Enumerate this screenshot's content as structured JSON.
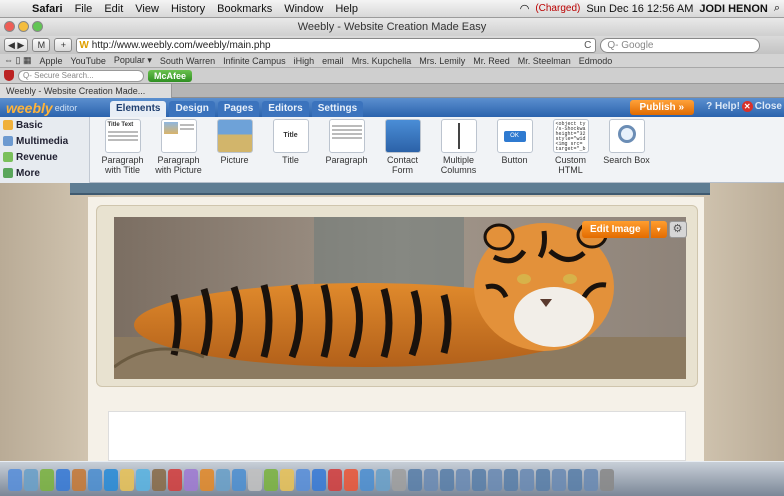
{
  "menubar": {
    "app": "Safari",
    "items": [
      "File",
      "Edit",
      "View",
      "History",
      "Bookmarks",
      "Window",
      "Help"
    ],
    "battery_status": "(Charged)",
    "datetime": "Sun Dec 16  12:56 AM",
    "user": "JODI HENON"
  },
  "window": {
    "title": "Weebly - Website Creation Made Easy"
  },
  "toolbar": {
    "url": "http://www.weebly.com/weebly/main.php",
    "search_placeholder": "Q- Google",
    "reload": "C"
  },
  "bookmarks": [
    "Apple",
    "YouTube",
    "Popular ▾",
    "South Warren",
    "Infinite Campus",
    "iHigh",
    "email",
    "Mrs. Kupchella",
    "Mrs. Lemily",
    "Mr. Reed",
    "Mr. Steelman",
    "Edmodo"
  ],
  "security_bar": {
    "search_placeholder": "Q- Secure Search...",
    "mcafee_label": "McAfee"
  },
  "tab": {
    "label": "Weebly - Website Creation Made..."
  },
  "weebly": {
    "logo": "weebly",
    "logo_sub": "editor",
    "tabs": [
      "Elements",
      "Design",
      "Pages",
      "Editors",
      "Settings"
    ],
    "active_tab": "Elements",
    "publish": "Publish »",
    "help": "Help!",
    "close": "Close"
  },
  "categories": [
    "Basic",
    "Multimedia",
    "Revenue",
    "More"
  ],
  "elements": [
    {
      "label": "Paragraph with Title",
      "thumb": "Title Text"
    },
    {
      "label": "Paragraph with Picture",
      "thumb": ""
    },
    {
      "label": "Picture",
      "thumb": ""
    },
    {
      "label": "Title",
      "thumb": "Title Text"
    },
    {
      "label": "Paragraph",
      "thumb": ""
    },
    {
      "label": "Contact Form",
      "thumb": ""
    },
    {
      "label": "Multiple Columns",
      "thumb": ""
    },
    {
      "label": "Button",
      "thumb": "OK"
    },
    {
      "label": "Custom HTML",
      "thumb": "<object ty /s-Shockwa height=\"32 style=\"wid <img src= target=\"_b"
    },
    {
      "label": "Search Box",
      "thumb": ""
    }
  ],
  "image_toolbar": {
    "edit": "Edit Image",
    "dropdown": "▾",
    "settings": "⚙"
  },
  "colors": {
    "accent": "#2b63ad",
    "publish": "#e06a00",
    "canvas": "#d8ccb8"
  }
}
